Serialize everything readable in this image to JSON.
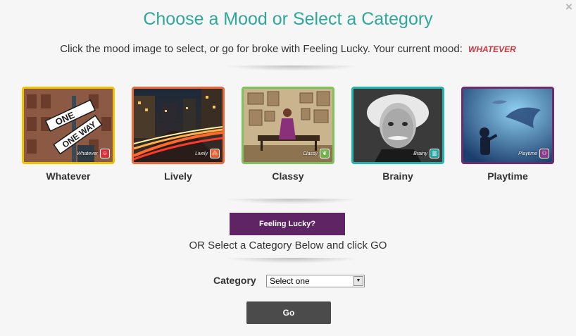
{
  "close_icon": "×",
  "header": {
    "title": "Choose a Mood or Select a Category",
    "subtitle": "Click the mood image to select, or go for broke with Feeling Lucky. Your current mood:",
    "current_mood": "WHATEVER"
  },
  "moods": [
    {
      "label": "Whatever",
      "badge": "Whatever",
      "border_color": "#f2c200",
      "icon": "smiley-icon",
      "badge_color": "#d8303a"
    },
    {
      "label": "Lively",
      "badge": "Lively",
      "border_color": "#ec6a3a",
      "icon": "dots-icon",
      "badge_color": "#e85d2c"
    },
    {
      "label": "Classy",
      "badge": "Classy",
      "border_color": "#7cc35a",
      "icon": "leaf-icon",
      "badge_color": "#6bb445"
    },
    {
      "label": "Brainy",
      "badge": "Brainy",
      "border_color": "#21b5ad",
      "icon": "book-icon",
      "badge_color": "#1ea7a0"
    },
    {
      "label": "Playtime",
      "badge": "Playtime",
      "border_color": "#6b2d6e",
      "icon": "people-icon",
      "badge_color": "#8a3a8c"
    }
  ],
  "lucky_button": "Feeling Lucky?",
  "or_text": "OR Select a Category Below and click GO",
  "category": {
    "label": "Category",
    "selected": "Select one"
  },
  "go_button": "Go"
}
